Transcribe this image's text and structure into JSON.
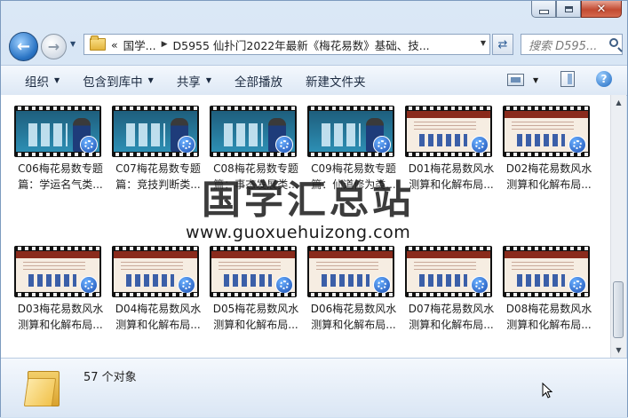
{
  "window": {
    "minimize_label": "minimize",
    "maximize_label": "maximize",
    "close_glyph": "✕"
  },
  "navigation": {
    "back_icon": "arrow-left-icon",
    "forward_icon": "arrow-right-icon",
    "breadcrumb_overflow": "«",
    "breadcrumb": [
      "国学...",
      "D5955 仙扑门2022年最新《梅花易数》基础、技..."
    ],
    "search_placeholder": "搜索 D595..."
  },
  "toolbar": {
    "organize": "组织",
    "include_in_library": "包含到库中",
    "share": "共享",
    "play_all": "全部播放",
    "new_folder": "新建文件夹"
  },
  "files": [
    {
      "line1": "C06梅花易数专题",
      "line2": "篇：学运名气类...",
      "style": "teal"
    },
    {
      "line1": "C07梅花易数专题",
      "line2": "篇：竞技判断类...",
      "style": "teal"
    },
    {
      "line1": "C08梅花易数专题",
      "line2": "篇：事态发展类...",
      "style": "teal"
    },
    {
      "line1": "C09梅花易数专题",
      "line2": "篇：仙道修为类...",
      "style": "teal"
    },
    {
      "line1": "D01梅花易数风水",
      "line2": "测算和化解布局...",
      "style": "slide"
    },
    {
      "line1": "D02梅花易数风水",
      "line2": "测算和化解布局...",
      "style": "slide"
    },
    {
      "line1": "D03梅花易数风水",
      "line2": "测算和化解布局...",
      "style": "slide"
    },
    {
      "line1": "D04梅花易数风水",
      "line2": "测算和化解布局...",
      "style": "slide"
    },
    {
      "line1": "D05梅花易数风水",
      "line2": "测算和化解布局...",
      "style": "slide"
    },
    {
      "line1": "D06梅花易数风水",
      "line2": "测算和化解布局...",
      "style": "slide"
    },
    {
      "line1": "D07梅花易数风水",
      "line2": "测算和化解布局...",
      "style": "slide"
    },
    {
      "line1": "D08梅花易数风水",
      "line2": "测算和化解布局...",
      "style": "slide"
    }
  ],
  "watermark": {
    "title": "国学汇总站",
    "url": "www.guoxuehuizong.com"
  },
  "status": {
    "count_text": "57 个对象"
  }
}
